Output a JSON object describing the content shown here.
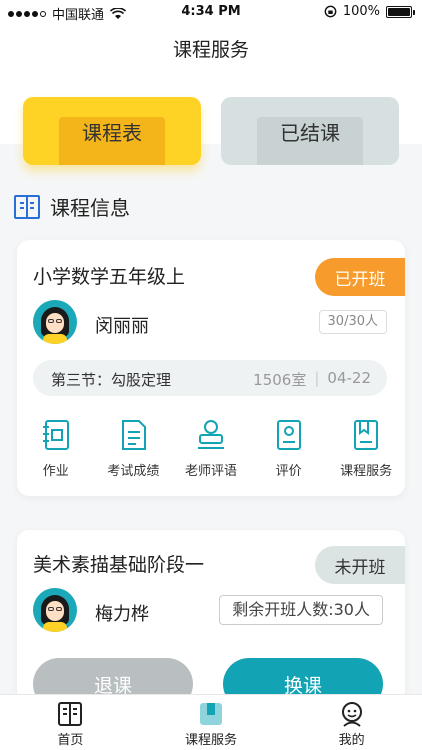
{
  "status_bar": {
    "carrier": "中国联通",
    "time": "4:34 PM",
    "battery": "100%"
  },
  "nav": {
    "title": "课程服务"
  },
  "tiles": {
    "schedule": "课程表",
    "completed": "已结课"
  },
  "section": {
    "title": "课程信息"
  },
  "courses": [
    {
      "name": "小学数学五年级上",
      "status": "已开班",
      "teacher": "闵丽丽",
      "enrollment": "30/30人",
      "lesson": "第三节：勾股定理",
      "room": "1506室",
      "date": "04-22",
      "actions": [
        {
          "label": "作业",
          "icon": "homework-icon"
        },
        {
          "label": "考试成绩",
          "icon": "exam-score-icon"
        },
        {
          "label": "老师评语",
          "icon": "teacher-comment-icon"
        },
        {
          "label": "评价",
          "icon": "evaluation-icon"
        },
        {
          "label": "课程服务",
          "icon": "course-service-icon"
        }
      ]
    },
    {
      "name": "美术素描基础阶段一",
      "status": "未开班",
      "teacher": "梅力桦",
      "remaining": "剩余开班人数:30人",
      "buttons": {
        "drop": "退课",
        "switch": "换课"
      }
    }
  ],
  "tabbar": [
    {
      "label": "首页",
      "icon": "home-icon",
      "active": false
    },
    {
      "label": "课程服务",
      "icon": "course-service-icon",
      "active": true
    },
    {
      "label": "我的",
      "icon": "profile-icon",
      "active": false
    }
  ],
  "colors": {
    "accent": "#12a4b4",
    "yellow": "#ffd326",
    "orange": "#f69b2c",
    "blue": "#2a6fd6"
  }
}
